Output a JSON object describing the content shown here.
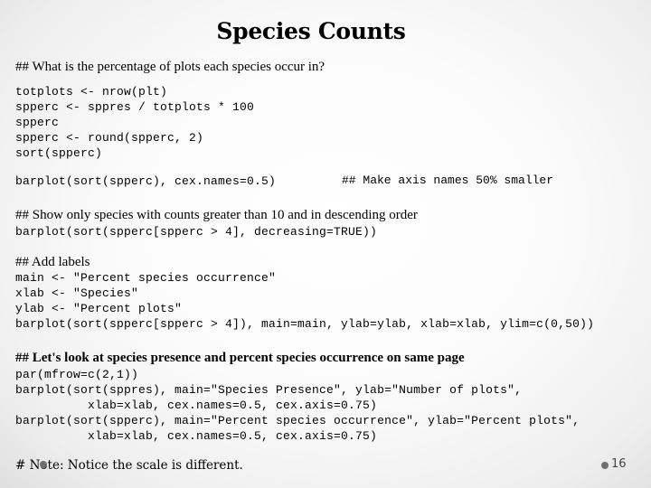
{
  "slide": {
    "title": "Species Counts",
    "section1": {
      "comment": "## What is the percentage of plots each species occur in?",
      "code": "totplots <- nrow(plt)\nspperc <- sppres / totplots * 100\nspperc\nspperc <- round(spperc, 2)\nsort(spperc)",
      "barplot_line": "barplot(sort(spperc), cex.names=0.5)",
      "barplot_comment": "## Make axis names 50% smaller"
    },
    "section2": {
      "comment": "## Show only species with counts greater than 10 and in descending order",
      "code": "barplot(sort(spperc[spperc > 4], decreasing=TRUE))"
    },
    "section3": {
      "comment": "## Add labels",
      "code": "main <- \"Percent species occurrence\"\nxlab <- \"Species\"\nylab <- \"Percent plots\"\nbarplot(sort(spperc[spperc > 4]), main=main, ylab=ylab, xlab=xlab, ylim=c(0,50))"
    },
    "section4": {
      "comment": "## Let's look at species presence and percent species occurrence on same page",
      "code": "par(mfrow=c(2,1))\nbarplot(sort(sppres), main=\"Species Presence\", ylab=\"Number of plots\",\n          xlab=xlab, cex.names=0.5, cex.axis=0.75)\nbarplot(sort(spperc), main=\"Percent species occurrence\", ylab=\"Percent plots\",\n          xlab=xlab, cex.names=0.5, cex.axis=0.75)"
    },
    "note": "# Note: Notice the scale is different.",
    "page_number": "16"
  }
}
